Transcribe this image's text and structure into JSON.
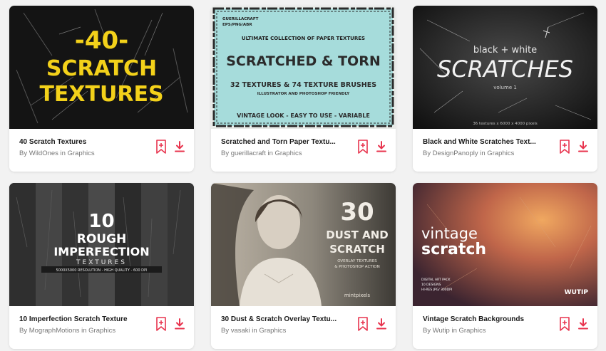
{
  "items": [
    {
      "title": "40 Scratch Textures",
      "byline": "By WildOnes in Graphics",
      "thumb_text": [
        "-40-",
        "SCRATCH",
        "TEXTURES"
      ]
    },
    {
      "title": "Scratched and Torn Paper Textu...",
      "byline": "By guerillacraft in Graphics",
      "thumb_text": [
        "GUERILLACRAFT",
        "EPS/PNG/ABR",
        "ULTIMATE COLLECTION OF PAPER TEXTURES",
        "SCRATCHED & TORN",
        "32 TEXTURES & 74 TEXTURE BRUSHES",
        "ILLUSTRATOR AND PHOTOSHOP FRIENDLY",
        "VINTAGE LOOK - EASY TO USE - VARIABLE"
      ]
    },
    {
      "title": "Black and White Scratches Text...",
      "byline": "By DesignPanoply in Graphics",
      "thumb_text": [
        "black + white",
        "SCRATCHES",
        "volume 1",
        "36 textures x 6000 x 4000 pixels"
      ]
    },
    {
      "title": "10 Imperfection Scratch Texture",
      "byline": "By MographMotions in Graphics",
      "thumb_text": [
        "10",
        "ROUGH",
        "IMPERFECTION",
        "TEXTURES",
        "5000X5000 RESOLUTION - HIGH QUALITY - 600 DPI"
      ]
    },
    {
      "title": "30 Dust & Scratch Overlay Textu...",
      "byline": "By vasaki in Graphics",
      "thumb_text": [
        "30",
        "DUST AND",
        "SCRATCH",
        "OVERLAY TEXTURES",
        "& PHOTOSHOP ACTION",
        "mintpixels"
      ]
    },
    {
      "title": "Vintage Scratch Backgrounds",
      "byline": "By Wutip in Graphics",
      "thumb_text": [
        "vintage",
        "scratch",
        "DIGITAL ART PACK",
        "10 DESIGNS",
        "HI-RES JPG/ 300DPI",
        "WUTIP"
      ]
    }
  ],
  "colors": {
    "accent": "#e8344e",
    "page_bg": "#f2f2f2",
    "card_bg": "#ffffff",
    "title": "#1a1a1a",
    "byline": "#777777",
    "yellow": "#f3d11a",
    "paper_blue": "#a6dcdb"
  },
  "icons": {
    "bookmark": "bookmark-add-icon",
    "download": "download-icon"
  }
}
